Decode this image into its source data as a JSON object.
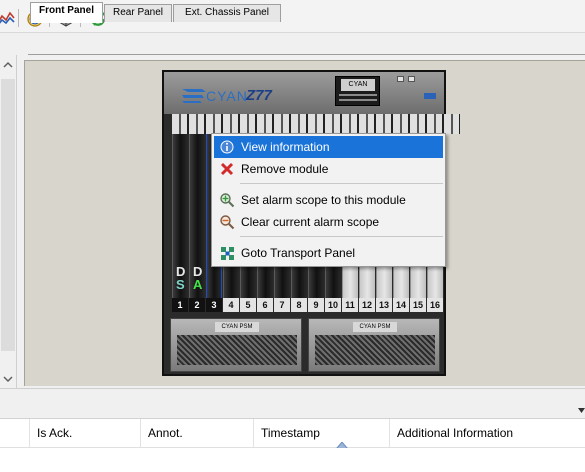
{
  "toolbar": {
    "buttons": [
      {
        "icon": "chart-icon"
      },
      {
        "icon": "clock-icon"
      },
      {
        "icon": "cube-icon"
      },
      {
        "icon": "refresh-icon"
      }
    ]
  },
  "tabs": [
    {
      "label": "Front Panel",
      "active": true
    },
    {
      "label": "Rear Panel",
      "active": false
    },
    {
      "label": "Ext. Chassis Panel",
      "active": false
    }
  ],
  "chassis": {
    "brand": "CYAN",
    "model": "Z77",
    "logo_box": "CYAN",
    "card_letters": [
      {
        "top": "D",
        "bottom": "S"
      },
      {
        "top": "D",
        "bottom": "A"
      }
    ],
    "slots": [
      "1",
      "2",
      "3",
      "4",
      "5",
      "6",
      "7",
      "8",
      "9",
      "10",
      "11",
      "12",
      "13",
      "14",
      "15",
      "16"
    ],
    "psu_label": "CYAN PSM"
  },
  "context_menu": {
    "items": [
      {
        "label": "View information",
        "icon": "info-icon",
        "selected": true
      },
      {
        "label": "Remove module",
        "icon": "remove-icon",
        "selected": false
      },
      {
        "label": "Set alarm scope to this module",
        "icon": "alarm-scope-set-icon",
        "selected": false
      },
      {
        "label": "Clear current alarm scope",
        "icon": "alarm-scope-clear-icon",
        "selected": false
      },
      {
        "label": "Goto Transport Panel",
        "icon": "transport-panel-icon",
        "selected": false
      }
    ]
  },
  "alarm_table": {
    "columns": [
      "Is Ack.",
      "Annot.",
      "Timestamp",
      "Additional Information"
    ],
    "sorted_column": "Timestamp",
    "sort_direction": "ascending"
  },
  "colors": {
    "selection": "#1a73d8",
    "canvas": "#d8d5cc",
    "brand": "#2b6fc4"
  }
}
